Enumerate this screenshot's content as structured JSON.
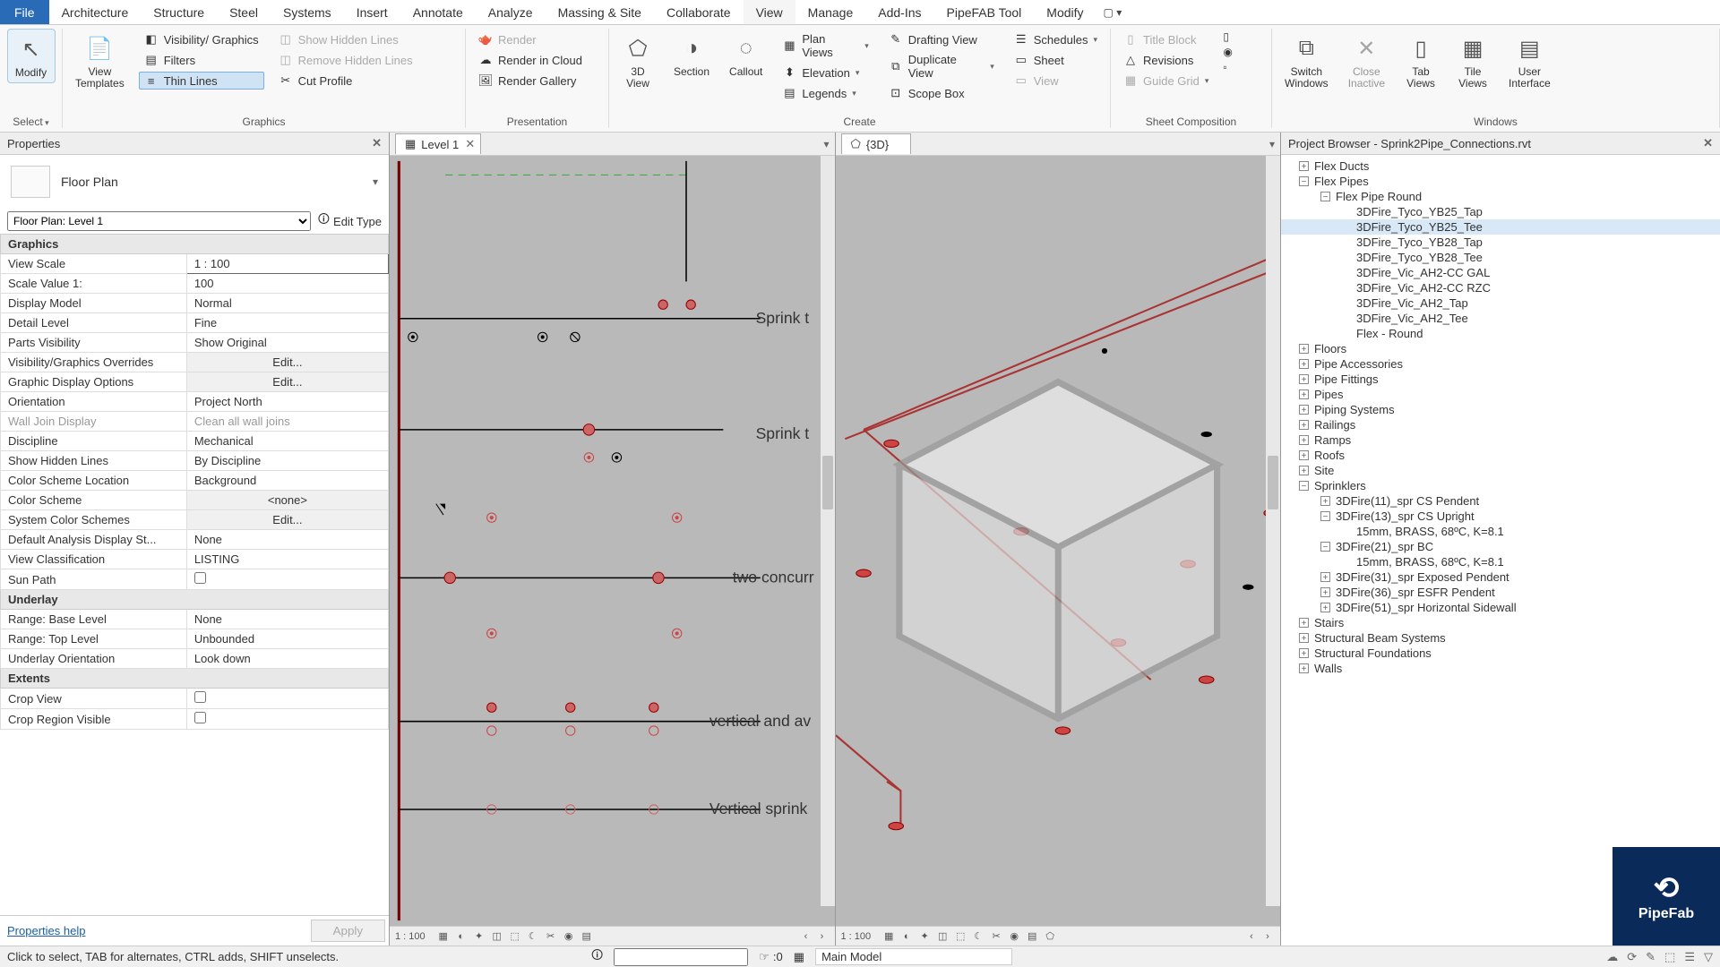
{
  "menu": {
    "file": "File",
    "items": [
      "Architecture",
      "Structure",
      "Steel",
      "Systems",
      "Insert",
      "Annotate",
      "Analyze",
      "Massing & Site",
      "Collaborate",
      "View",
      "Manage",
      "Add-Ins",
      "PipeFAB Tool",
      "Modify"
    ],
    "active": "View"
  },
  "ribbon": {
    "select": {
      "modify": "Modify",
      "select": "Select"
    },
    "graphics": {
      "title": "Graphics",
      "templates": "View\nTemplates",
      "vis": "Visibility/ Graphics",
      "filters": "Filters",
      "thin": "Thin  Lines",
      "show": "Show  Hidden Lines",
      "remove": "Remove  Hidden Lines",
      "cut": "Cut  Profile"
    },
    "presentation": {
      "title": "Presentation",
      "render": "Render",
      "cloud": "Render  in Cloud",
      "gallery": "Render  Gallery"
    },
    "create": {
      "title": "Create",
      "v3d": "3D\nView",
      "section": "Section",
      "callout": "Callout",
      "plan": "Plan  Views",
      "elev": "Elevation",
      "legend": "Legends",
      "draft": "Drafting  View",
      "dup": "Duplicate  View",
      "scope": "Scope  Box",
      "sched": "Schedules",
      "sheet": "Sheet",
      "view": "View"
    },
    "sheet": {
      "title": "Sheet Composition",
      "title_block": "Title  Block",
      "rev": "Revisions",
      "guide": "Guide  Grid"
    },
    "windows": {
      "title": "Windows",
      "switch": "Switch\nWindows",
      "close": "Close\nInactive",
      "tab": "Tab\nViews",
      "tile": "Tile\nViews",
      "ui": "User\nInterface"
    }
  },
  "props": {
    "title": "Properties",
    "type": "Floor Plan",
    "instance": "Floor Plan: Level 1",
    "edit_type": "Edit Type",
    "sections": {
      "graphics": "Graphics",
      "underlay": "Underlay",
      "extents": "Extents"
    },
    "rows": {
      "view_scale": {
        "l": "View Scale",
        "v": "1 : 100"
      },
      "scale_value": {
        "l": "Scale Value    1:",
        "v": "100"
      },
      "display_model": {
        "l": "Display Model",
        "v": "Normal"
      },
      "detail": {
        "l": "Detail Level",
        "v": "Fine"
      },
      "parts": {
        "l": "Parts Visibility",
        "v": "Show Original"
      },
      "vgo": {
        "l": "Visibility/Graphics Overrides",
        "v": "Edit..."
      },
      "gdo": {
        "l": "Graphic Display Options",
        "v": "Edit..."
      },
      "orient": {
        "l": "Orientation",
        "v": "Project North"
      },
      "wall": {
        "l": "Wall Join Display",
        "v": "Clean all wall joins"
      },
      "disc": {
        "l": "Discipline",
        "v": "Mechanical"
      },
      "shl": {
        "l": "Show Hidden Lines",
        "v": "By Discipline"
      },
      "csl": {
        "l": "Color Scheme Location",
        "v": "Background"
      },
      "cs": {
        "l": "Color Scheme",
        "v": "<none>"
      },
      "scs": {
        "l": "System Color Schemes",
        "v": "Edit..."
      },
      "dads": {
        "l": "Default Analysis Display St...",
        "v": "None"
      },
      "vc": {
        "l": "View Classification",
        "v": "LISTING"
      },
      "sun": {
        "l": "Sun Path",
        "v": ""
      },
      "rbl": {
        "l": "Range: Base Level",
        "v": "None"
      },
      "rtl": {
        "l": "Range: Top Level",
        "v": "Unbounded"
      },
      "uo": {
        "l": "Underlay Orientation",
        "v": "Look down"
      },
      "crop": {
        "l": "Crop View",
        "v": ""
      },
      "crv": {
        "l": "Crop Region Visible",
        "v": ""
      }
    },
    "help": "Properties help",
    "apply": "Apply"
  },
  "tabs": {
    "level1": "Level 1",
    "v3d": "{3D}"
  },
  "canvas1": {
    "labels": [
      "Sprink t",
      "Sprink t",
      "two concurr",
      "vertical and av",
      "Vertical sprink"
    ],
    "scale": "1 : 100"
  },
  "canvas2": {
    "scale": "1 : 100"
  },
  "browser": {
    "title": "Project Browser - Sprink2Pipe_Connections.rvt",
    "flex_ducts": "Flex Ducts",
    "flex_pipes": "Flex Pipes",
    "fpr": "Flex Pipe Round",
    "fpr_items": [
      "3DFire_Tyco_YB25_Tap",
      "3DFire_Tyco_YB25_Tee",
      "3DFire_Tyco_YB28_Tap",
      "3DFire_Tyco_YB28_Tee",
      "3DFire_Vic_AH2-CC GAL",
      "3DFire_Vic_AH2-CC RZC",
      "3DFire_Vic_AH2_Tap",
      "3DFire_Vic_AH2_Tee",
      "Flex - Round"
    ],
    "floors": "Floors",
    "pipe_acc": "Pipe Accessories",
    "pipe_fit": "Pipe Fittings",
    "pipes": "Pipes",
    "piping": "Piping Systems",
    "railings": "Railings",
    "ramps": "Ramps",
    "roofs": "Roofs",
    "site": "Site",
    "sprinklers": "Sprinklers",
    "spr11": "3DFire(11)_spr CS Pendent",
    "spr13": "3DFire(13)_spr CS Upright",
    "spr13c": "15mm, BRASS, 68ºC, K=8.1",
    "spr21": "3DFire(21)_spr BC",
    "spr21c": "15mm, BRASS, 68ºC, K=8.1",
    "spr31": "3DFire(31)_spr Exposed Pendent",
    "spr36": "3DFire(36)_spr ESFR Pendent",
    "spr51": "3DFire(51)_spr Horizontal Sidewall",
    "stairs": "Stairs",
    "sbs": "Structural Beam Systems",
    "sf": "Structural Foundations",
    "walls": "Walls"
  },
  "status": {
    "msg": "Click to select, TAB for alternates, CTRL adds, SHIFT unselects.",
    "zero": ":0",
    "main": "Main Model"
  },
  "pipefab": "PipeFab"
}
